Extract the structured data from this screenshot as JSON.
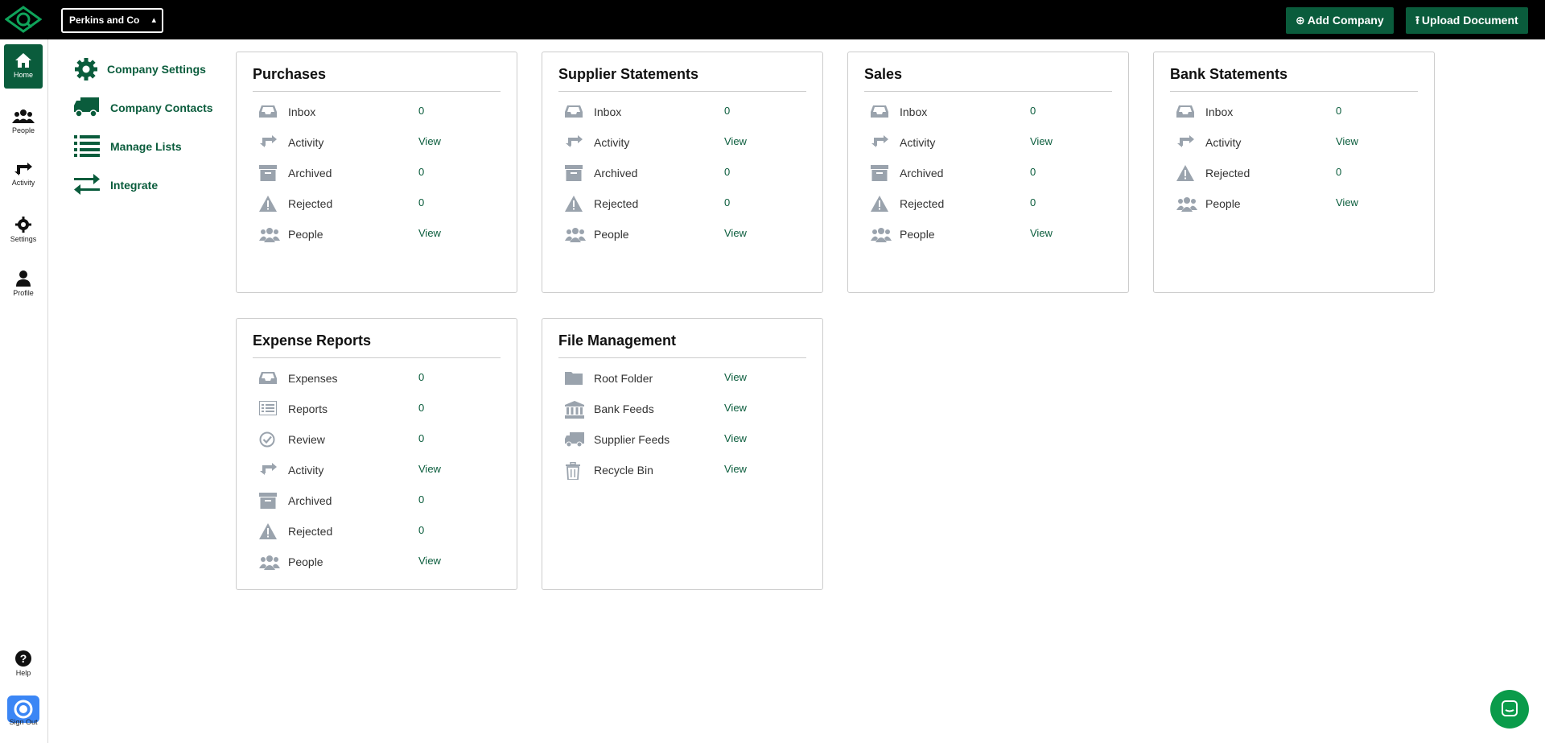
{
  "topbar": {
    "company_name": "Perkins and Co",
    "add_company_label": "Add Company",
    "upload_document_label": "Upload Document"
  },
  "rail": {
    "home": "Home",
    "people": "People",
    "activity": "Activity",
    "settings": "Settings",
    "profile": "Profile",
    "help": "Help",
    "signout": "Sign Out"
  },
  "settings_nav": {
    "company_settings": "Company Settings",
    "company_contacts": "Company Contacts",
    "manage_lists": "Manage Lists",
    "integrate": "Integrate"
  },
  "cards": {
    "purchases": {
      "title": "Purchases",
      "rows": [
        {
          "icon": "inbox-icon",
          "label": "Inbox",
          "value": "0"
        },
        {
          "icon": "activity-icon",
          "label": "Activity",
          "value": "View"
        },
        {
          "icon": "archive-icon",
          "label": "Archived",
          "value": "0"
        },
        {
          "icon": "warning-icon",
          "label": "Rejected",
          "value": "0"
        },
        {
          "icon": "people-icon",
          "label": "People",
          "value": "View"
        }
      ]
    },
    "supplier_statements": {
      "title": "Supplier Statements",
      "rows": [
        {
          "icon": "inbox-icon",
          "label": "Inbox",
          "value": "0"
        },
        {
          "icon": "activity-icon",
          "label": "Activity",
          "value": "View"
        },
        {
          "icon": "archive-icon",
          "label": "Archived",
          "value": "0"
        },
        {
          "icon": "warning-icon",
          "label": "Rejected",
          "value": "0"
        },
        {
          "icon": "people-icon",
          "label": "People",
          "value": "View"
        }
      ]
    },
    "sales": {
      "title": "Sales",
      "rows": [
        {
          "icon": "inbox-icon",
          "label": "Inbox",
          "value": "0"
        },
        {
          "icon": "activity-icon",
          "label": "Activity",
          "value": "View"
        },
        {
          "icon": "archive-icon",
          "label": "Archived",
          "value": "0"
        },
        {
          "icon": "warning-icon",
          "label": "Rejected",
          "value": "0"
        },
        {
          "icon": "people-icon",
          "label": "People",
          "value": "View"
        }
      ]
    },
    "bank_statements": {
      "title": "Bank Statements",
      "rows": [
        {
          "icon": "inbox-icon",
          "label": "Inbox",
          "value": "0"
        },
        {
          "icon": "activity-icon",
          "label": "Activity",
          "value": "View"
        },
        {
          "icon": "warning-icon",
          "label": "Rejected",
          "value": "0"
        },
        {
          "icon": "people-icon",
          "label": "People",
          "value": "View"
        }
      ]
    },
    "expense_reports": {
      "title": "Expense Reports",
      "rows": [
        {
          "icon": "inbox-icon",
          "label": "Expenses",
          "value": "0"
        },
        {
          "icon": "list-icon",
          "label": "Reports",
          "value": "0"
        },
        {
          "icon": "check-circle-icon",
          "label": "Review",
          "value": "0"
        },
        {
          "icon": "activity-icon",
          "label": "Activity",
          "value": "View"
        },
        {
          "icon": "archive-icon",
          "label": "Archived",
          "value": "0"
        },
        {
          "icon": "warning-icon",
          "label": "Rejected",
          "value": "0"
        },
        {
          "icon": "people-icon",
          "label": "People",
          "value": "View"
        }
      ]
    },
    "file_management": {
      "title": "File Management",
      "rows": [
        {
          "icon": "folder-icon",
          "label": "Root Folder",
          "value": "View"
        },
        {
          "icon": "bank-icon",
          "label": "Bank Feeds",
          "value": "View"
        },
        {
          "icon": "truck-icon",
          "label": "Supplier Feeds",
          "value": "View"
        },
        {
          "icon": "trash-icon",
          "label": "Recycle Bin",
          "value": "View"
        }
      ]
    }
  },
  "colors": {
    "brand_green": "#0a5c3c",
    "icon_gray": "#9aa3ad",
    "chat_green": "#0a9b4a"
  }
}
